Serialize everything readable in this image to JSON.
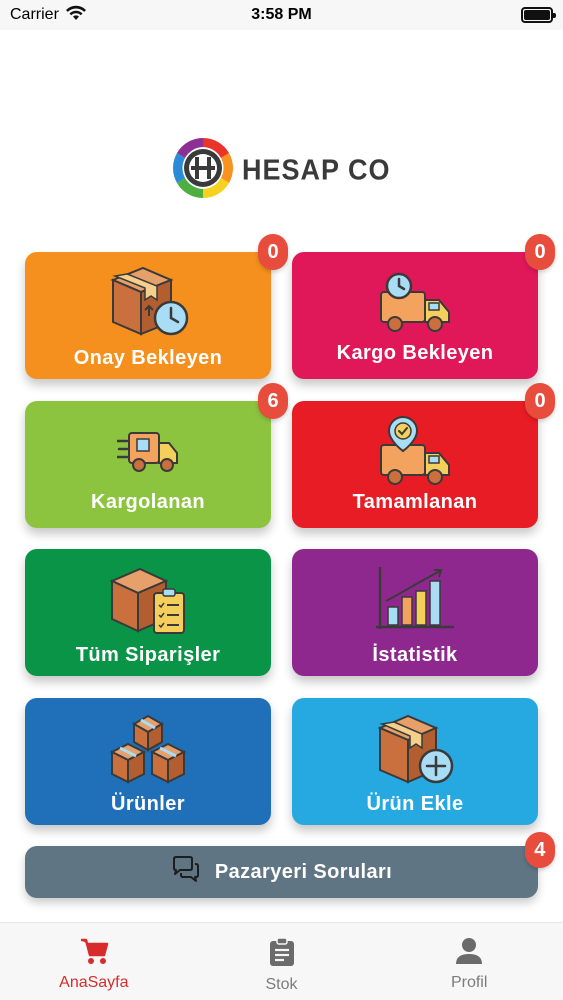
{
  "status_bar": {
    "carrier": "Carrier",
    "time": "3:58 PM",
    "battery_level": 1.0
  },
  "logo": {
    "text": "HESAP CO"
  },
  "tiles": [
    {
      "label": "Onay Bekleyen",
      "badge": "0",
      "color": "#f5901e",
      "icon": "box-clock-icon"
    },
    {
      "label": "Kargo Bekleyen",
      "badge": "0",
      "color": "#e0185a",
      "icon": "truck-clock-icon"
    },
    {
      "label": "Kargolanan",
      "badge": "6",
      "color": "#8cc43f",
      "icon": "delivery-truck-icon"
    },
    {
      "label": "Tamamlanan",
      "badge": "0",
      "color": "#e81c24",
      "icon": "truck-check-icon"
    },
    {
      "label": "Tüm Siparişler",
      "badge": "",
      "color": "#0a9447",
      "icon": "box-clipboard-icon"
    },
    {
      "label": "İstatistik",
      "badge": "",
      "color": "#8e288f",
      "icon": "bar-chart-icon"
    },
    {
      "label": "Ürünler",
      "badge": "",
      "color": "#1f70b8",
      "icon": "boxes-icon"
    },
    {
      "label": "Ürün Ekle",
      "badge": "",
      "color": "#26a9e1",
      "icon": "box-plus-icon"
    }
  ],
  "pazar": {
    "label": "Pazaryeri Soruları",
    "badge": "4",
    "color": "#5f7584",
    "icon": "chat-bubbles-icon"
  },
  "tab_bar": {
    "items": [
      {
        "label": "AnaSayfa",
        "icon": "cart-icon",
        "active": true
      },
      {
        "label": "Stok",
        "icon": "clipboard-icon",
        "active": false
      },
      {
        "label": "Profil",
        "icon": "user-icon",
        "active": false
      }
    ],
    "active_color": "#d82c2c",
    "inactive_color": "#7c7c7c"
  }
}
